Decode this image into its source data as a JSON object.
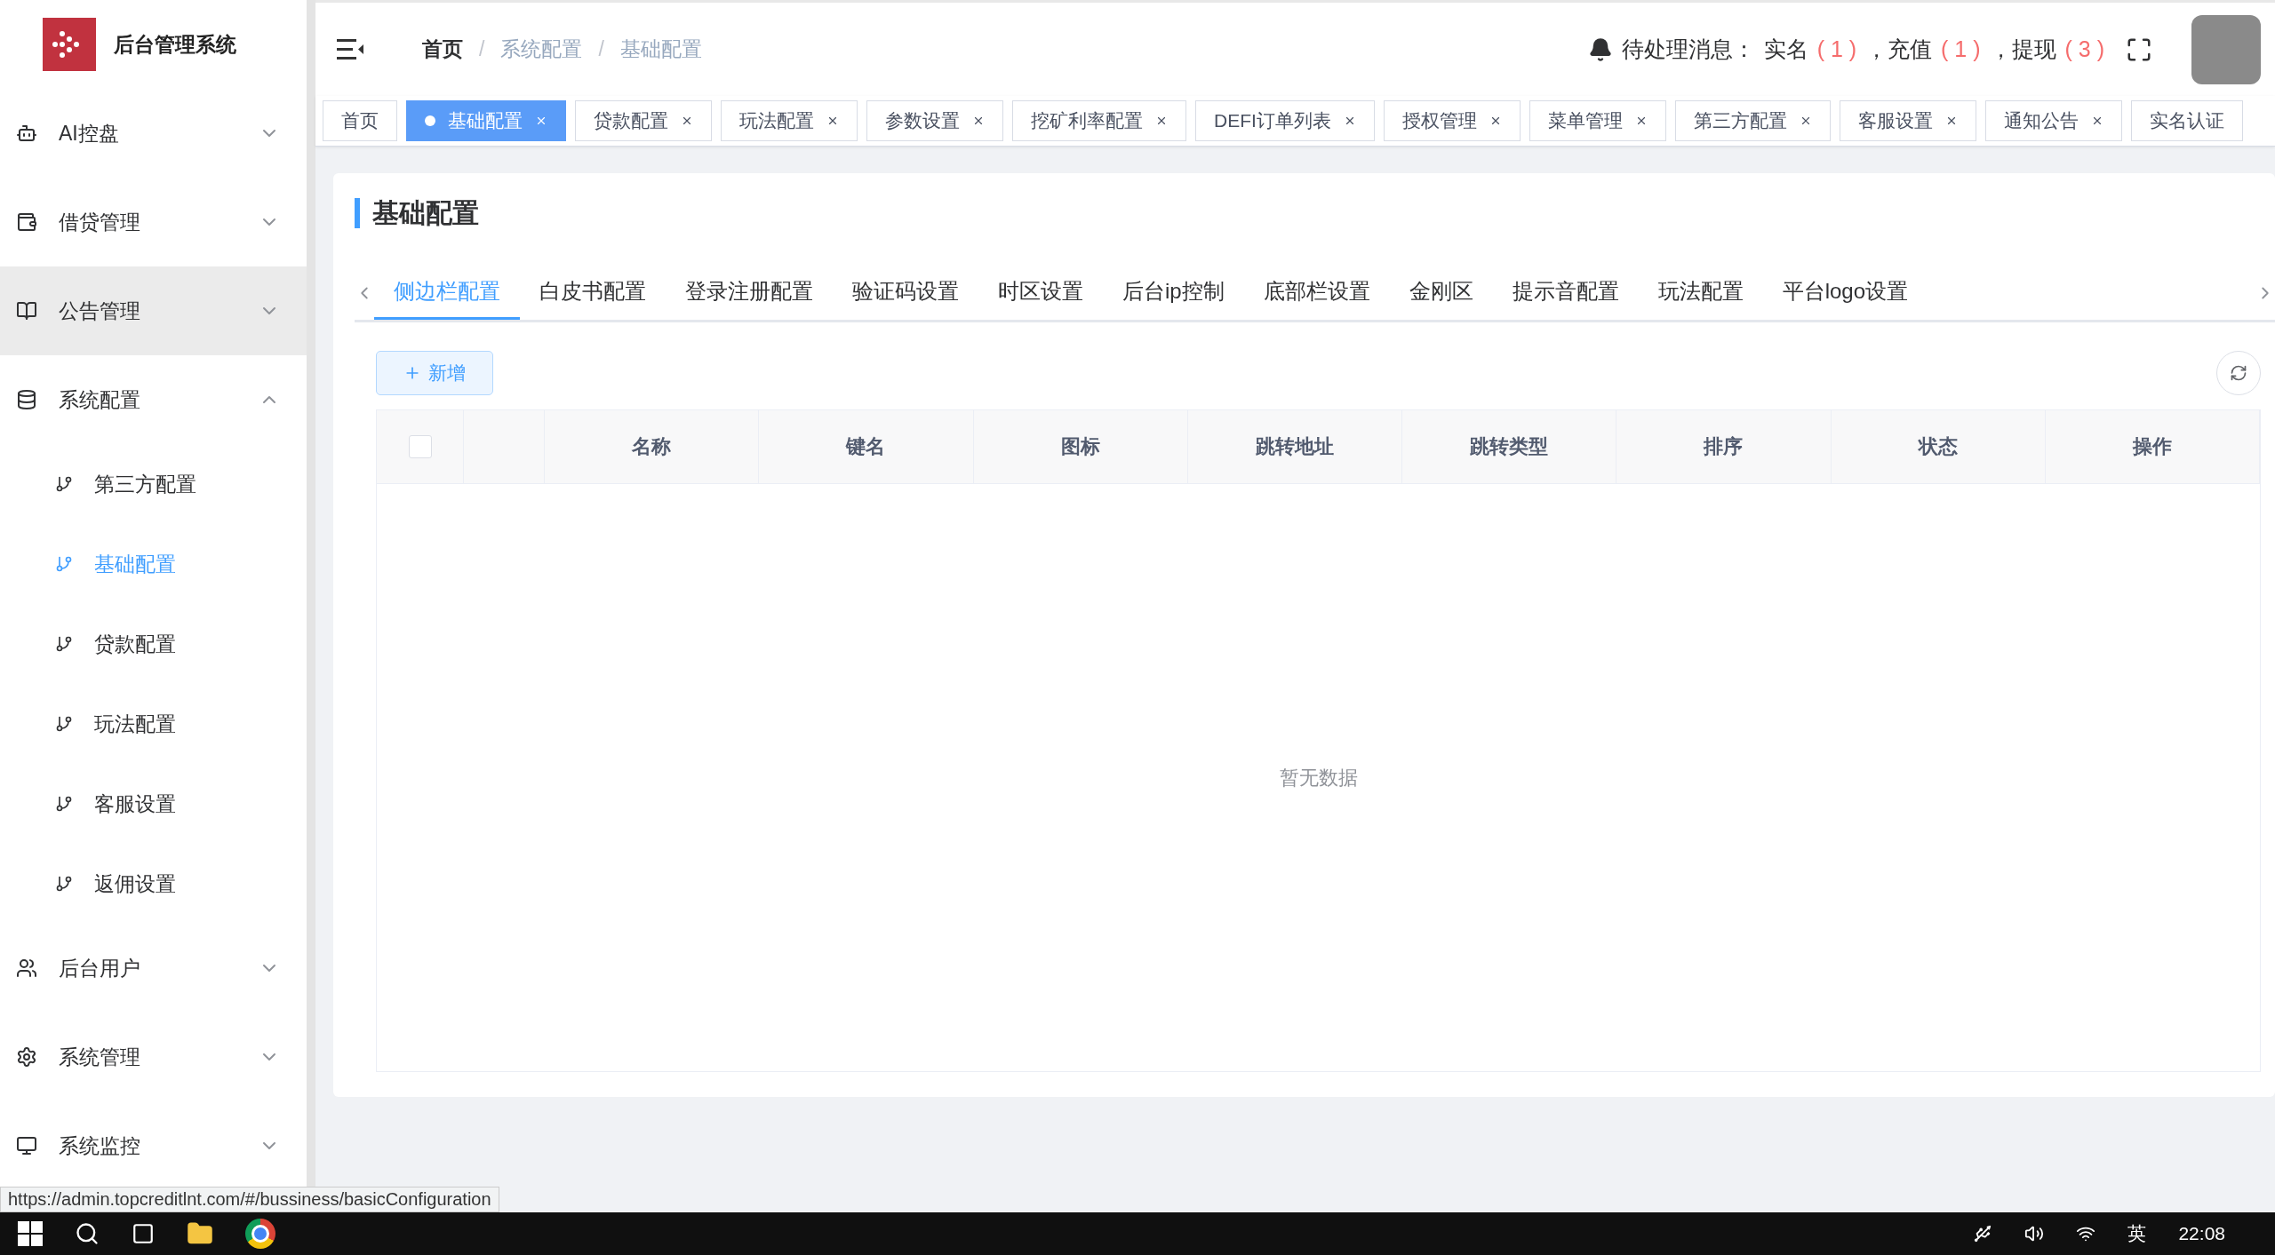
{
  "app": {
    "title": "后台管理系统"
  },
  "sidebar": {
    "items": [
      {
        "label": "AI控盘",
        "expanded": false,
        "hovered": false
      },
      {
        "label": "借贷管理",
        "expanded": false,
        "hovered": false
      },
      {
        "label": "公告管理",
        "expanded": false,
        "hovered": true
      },
      {
        "label": "系统配置",
        "expanded": true,
        "hovered": false,
        "children": [
          {
            "label": "第三方配置",
            "selected": false
          },
          {
            "label": "基础配置",
            "selected": true
          },
          {
            "label": "贷款配置",
            "selected": false
          },
          {
            "label": "玩法配置",
            "selected": false
          },
          {
            "label": "客服设置",
            "selected": false
          },
          {
            "label": "返佣设置",
            "selected": false
          }
        ]
      },
      {
        "label": "后台用户",
        "expanded": false,
        "hovered": false
      },
      {
        "label": "系统管理",
        "expanded": false,
        "hovered": false
      },
      {
        "label": "系统监控",
        "expanded": false,
        "hovered": false
      }
    ]
  },
  "header": {
    "breadcrumb": [
      "首页",
      "系统配置",
      "基础配置"
    ],
    "breadcrumb_separator": "/",
    "notice": {
      "prefix": "待处理消息：",
      "items": [
        {
          "label": "实名",
          "count": "( 1 )"
        },
        {
          "label": "，充值",
          "count": "( 1 )"
        },
        {
          "label": "，提现",
          "count": "( 3 )"
        }
      ]
    }
  },
  "tags": [
    {
      "label": "首页",
      "selected": false,
      "closable": false
    },
    {
      "label": "基础配置",
      "selected": true,
      "closable": true
    },
    {
      "label": "贷款配置",
      "selected": false,
      "closable": true
    },
    {
      "label": "玩法配置",
      "selected": false,
      "closable": true
    },
    {
      "label": "参数设置",
      "selected": false,
      "closable": true
    },
    {
      "label": "挖矿利率配置",
      "selected": false,
      "closable": true
    },
    {
      "label": "DEFI订单列表",
      "selected": false,
      "closable": true
    },
    {
      "label": "授权管理",
      "selected": false,
      "closable": true
    },
    {
      "label": "菜单管理",
      "selected": false,
      "closable": true
    },
    {
      "label": "第三方配置",
      "selected": false,
      "closable": true
    },
    {
      "label": "客服设置",
      "selected": false,
      "closable": true
    },
    {
      "label": "通知公告",
      "selected": false,
      "closable": true
    },
    {
      "label": "实名认证",
      "selected": false,
      "closable": false
    }
  ],
  "page": {
    "title": "基础配置",
    "tabs": [
      {
        "label": "侧边栏配置",
        "selected": true
      },
      {
        "label": "白皮书配置",
        "selected": false
      },
      {
        "label": "登录注册配置",
        "selected": false
      },
      {
        "label": "验证码设置",
        "selected": false
      },
      {
        "label": "时区设置",
        "selected": false
      },
      {
        "label": "后台ip控制",
        "selected": false
      },
      {
        "label": "底部栏设置",
        "selected": false
      },
      {
        "label": "金刚区",
        "selected": false
      },
      {
        "label": "提示音配置",
        "selected": false
      },
      {
        "label": "玩法配置",
        "selected": false
      },
      {
        "label": "平台logo设置",
        "selected": false
      }
    ],
    "add_button": "新增",
    "table": {
      "select_all_checked": false,
      "columns": [
        "名称",
        "键名",
        "图标",
        "跳转地址",
        "跳转类型",
        "排序",
        "状态",
        "操作"
      ],
      "empty_text": "暂无数据"
    }
  },
  "status_url": "https://admin.topcreditlnt.com/#/bussiness/basicConfiguration",
  "taskbar": {
    "ime": "英",
    "time": "22:08"
  }
}
